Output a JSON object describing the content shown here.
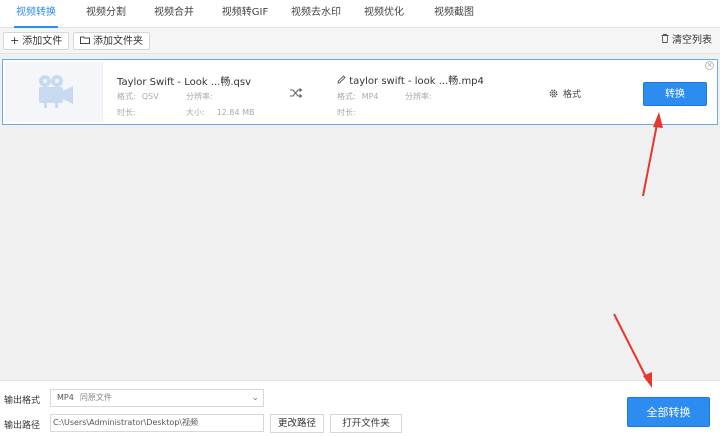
{
  "tabs": [
    {
      "label": "视频转换",
      "active": true
    },
    {
      "label": "视频分割",
      "active": false
    },
    {
      "label": "视频合并",
      "active": false
    },
    {
      "label": "视频转GIF",
      "active": false
    },
    {
      "label": "视频去水印",
      "active": false
    },
    {
      "label": "视频优化",
      "active": false
    },
    {
      "label": "视频截图",
      "active": false
    }
  ],
  "toolbar": {
    "add_file": "添加文件",
    "add_folder": "添加文件夹",
    "clear_list": "清空列表"
  },
  "file": {
    "source_name": "Taylor Swift - Look ...畅.qsv",
    "source_format_label": "格式:",
    "source_format": "QSV",
    "source_resolution_label": "分辨率:",
    "source_resolution": "",
    "source_duration_label": "时长:",
    "source_duration": "",
    "source_size_label": "大小:",
    "source_size": "12.84 MB",
    "output_name": "taylor swift - look ...畅.mp4",
    "output_format_label": "格式:",
    "output_format": "MP4",
    "output_resolution_label": "分辨率:",
    "output_resolution": "",
    "output_duration_label": "时长:",
    "output_duration": "",
    "settings_label": "格式",
    "convert_label": "转换"
  },
  "bottom": {
    "output_format_label": "输出格式",
    "output_format_value": "MP4",
    "output_format_sub": "同原文件",
    "output_path_label": "输出路径",
    "output_path_value": "C:\\Users\\Administrator\\Desktop\\视频",
    "change_path": "更改路径",
    "open_folder": "打开文件夹",
    "convert_all": "全部转换"
  },
  "colors": {
    "accent": "#2d8cf0",
    "annotation_arrow": "#e8362d"
  }
}
